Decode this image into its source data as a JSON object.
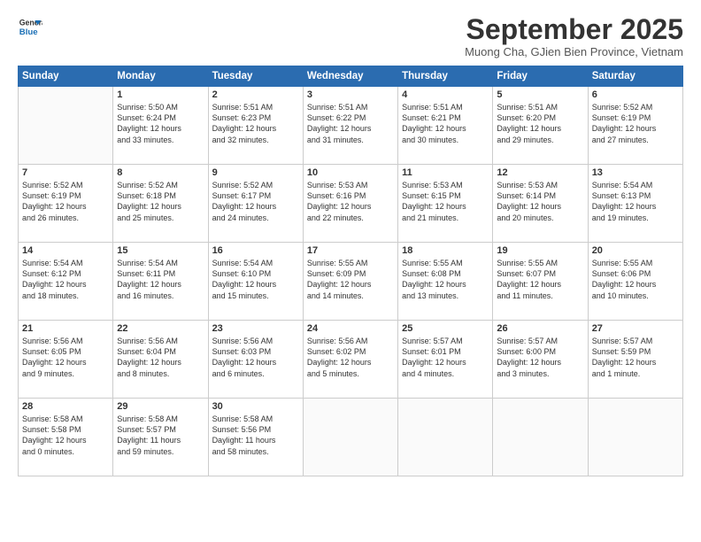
{
  "header": {
    "logo_line1": "General",
    "logo_line2": "Blue",
    "month": "September 2025",
    "location": "Muong Cha, GJien Bien Province, Vietnam"
  },
  "weekdays": [
    "Sunday",
    "Monday",
    "Tuesday",
    "Wednesday",
    "Thursday",
    "Friday",
    "Saturday"
  ],
  "weeks": [
    [
      {
        "day": "",
        "text": ""
      },
      {
        "day": "1",
        "text": "Sunrise: 5:50 AM\nSunset: 6:24 PM\nDaylight: 12 hours\nand 33 minutes."
      },
      {
        "day": "2",
        "text": "Sunrise: 5:51 AM\nSunset: 6:23 PM\nDaylight: 12 hours\nand 32 minutes."
      },
      {
        "day": "3",
        "text": "Sunrise: 5:51 AM\nSunset: 6:22 PM\nDaylight: 12 hours\nand 31 minutes."
      },
      {
        "day": "4",
        "text": "Sunrise: 5:51 AM\nSunset: 6:21 PM\nDaylight: 12 hours\nand 30 minutes."
      },
      {
        "day": "5",
        "text": "Sunrise: 5:51 AM\nSunset: 6:20 PM\nDaylight: 12 hours\nand 29 minutes."
      },
      {
        "day": "6",
        "text": "Sunrise: 5:52 AM\nSunset: 6:19 PM\nDaylight: 12 hours\nand 27 minutes."
      }
    ],
    [
      {
        "day": "7",
        "text": "Sunrise: 5:52 AM\nSunset: 6:19 PM\nDaylight: 12 hours\nand 26 minutes."
      },
      {
        "day": "8",
        "text": "Sunrise: 5:52 AM\nSunset: 6:18 PM\nDaylight: 12 hours\nand 25 minutes."
      },
      {
        "day": "9",
        "text": "Sunrise: 5:52 AM\nSunset: 6:17 PM\nDaylight: 12 hours\nand 24 minutes."
      },
      {
        "day": "10",
        "text": "Sunrise: 5:53 AM\nSunset: 6:16 PM\nDaylight: 12 hours\nand 22 minutes."
      },
      {
        "day": "11",
        "text": "Sunrise: 5:53 AM\nSunset: 6:15 PM\nDaylight: 12 hours\nand 21 minutes."
      },
      {
        "day": "12",
        "text": "Sunrise: 5:53 AM\nSunset: 6:14 PM\nDaylight: 12 hours\nand 20 minutes."
      },
      {
        "day": "13",
        "text": "Sunrise: 5:54 AM\nSunset: 6:13 PM\nDaylight: 12 hours\nand 19 minutes."
      }
    ],
    [
      {
        "day": "14",
        "text": "Sunrise: 5:54 AM\nSunset: 6:12 PM\nDaylight: 12 hours\nand 18 minutes."
      },
      {
        "day": "15",
        "text": "Sunrise: 5:54 AM\nSunset: 6:11 PM\nDaylight: 12 hours\nand 16 minutes."
      },
      {
        "day": "16",
        "text": "Sunrise: 5:54 AM\nSunset: 6:10 PM\nDaylight: 12 hours\nand 15 minutes."
      },
      {
        "day": "17",
        "text": "Sunrise: 5:55 AM\nSunset: 6:09 PM\nDaylight: 12 hours\nand 14 minutes."
      },
      {
        "day": "18",
        "text": "Sunrise: 5:55 AM\nSunset: 6:08 PM\nDaylight: 12 hours\nand 13 minutes."
      },
      {
        "day": "19",
        "text": "Sunrise: 5:55 AM\nSunset: 6:07 PM\nDaylight: 12 hours\nand 11 minutes."
      },
      {
        "day": "20",
        "text": "Sunrise: 5:55 AM\nSunset: 6:06 PM\nDaylight: 12 hours\nand 10 minutes."
      }
    ],
    [
      {
        "day": "21",
        "text": "Sunrise: 5:56 AM\nSunset: 6:05 PM\nDaylight: 12 hours\nand 9 minutes."
      },
      {
        "day": "22",
        "text": "Sunrise: 5:56 AM\nSunset: 6:04 PM\nDaylight: 12 hours\nand 8 minutes."
      },
      {
        "day": "23",
        "text": "Sunrise: 5:56 AM\nSunset: 6:03 PM\nDaylight: 12 hours\nand 6 minutes."
      },
      {
        "day": "24",
        "text": "Sunrise: 5:56 AM\nSunset: 6:02 PM\nDaylight: 12 hours\nand 5 minutes."
      },
      {
        "day": "25",
        "text": "Sunrise: 5:57 AM\nSunset: 6:01 PM\nDaylight: 12 hours\nand 4 minutes."
      },
      {
        "day": "26",
        "text": "Sunrise: 5:57 AM\nSunset: 6:00 PM\nDaylight: 12 hours\nand 3 minutes."
      },
      {
        "day": "27",
        "text": "Sunrise: 5:57 AM\nSunset: 5:59 PM\nDaylight: 12 hours\nand 1 minute."
      }
    ],
    [
      {
        "day": "28",
        "text": "Sunrise: 5:58 AM\nSunset: 5:58 PM\nDaylight: 12 hours\nand 0 minutes."
      },
      {
        "day": "29",
        "text": "Sunrise: 5:58 AM\nSunset: 5:57 PM\nDaylight: 11 hours\nand 59 minutes."
      },
      {
        "day": "30",
        "text": "Sunrise: 5:58 AM\nSunset: 5:56 PM\nDaylight: 11 hours\nand 58 minutes."
      },
      {
        "day": "",
        "text": ""
      },
      {
        "day": "",
        "text": ""
      },
      {
        "day": "",
        "text": ""
      },
      {
        "day": "",
        "text": ""
      }
    ]
  ]
}
